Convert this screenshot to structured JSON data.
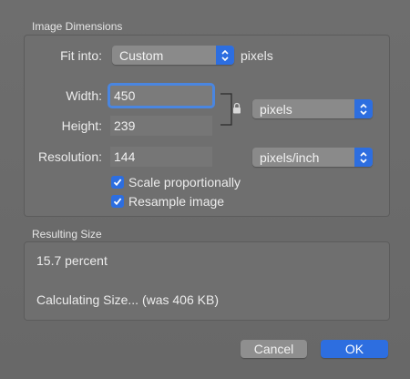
{
  "dialog": {
    "image_dimensions_title": "Image Dimensions",
    "fit_into": {
      "label": "Fit into:",
      "value": "Custom",
      "suffix": "pixels"
    },
    "width": {
      "label": "Width:",
      "value": "450"
    },
    "height": {
      "label": "Height:",
      "value": "239"
    },
    "units": {
      "value": "pixels"
    },
    "resolution": {
      "label": "Resolution:",
      "value": "144",
      "unit": "pixels/inch"
    },
    "scale_proportionally": {
      "label": "Scale proportionally",
      "checked": true
    },
    "resample_image": {
      "label": "Resample image",
      "checked": true
    },
    "resulting_size_title": "Resulting Size",
    "percent": "15.7 percent",
    "size_status": "Calculating Size... (was 406 KB)",
    "cancel_label": "Cancel",
    "ok_label": "OK"
  },
  "colors": {
    "accent": "#2d6ee0",
    "background": "#6b6b6b"
  },
  "icons": {
    "lock": "lock-icon",
    "stepper": "stepper-arrows-icon",
    "check": "checkmark-icon"
  }
}
